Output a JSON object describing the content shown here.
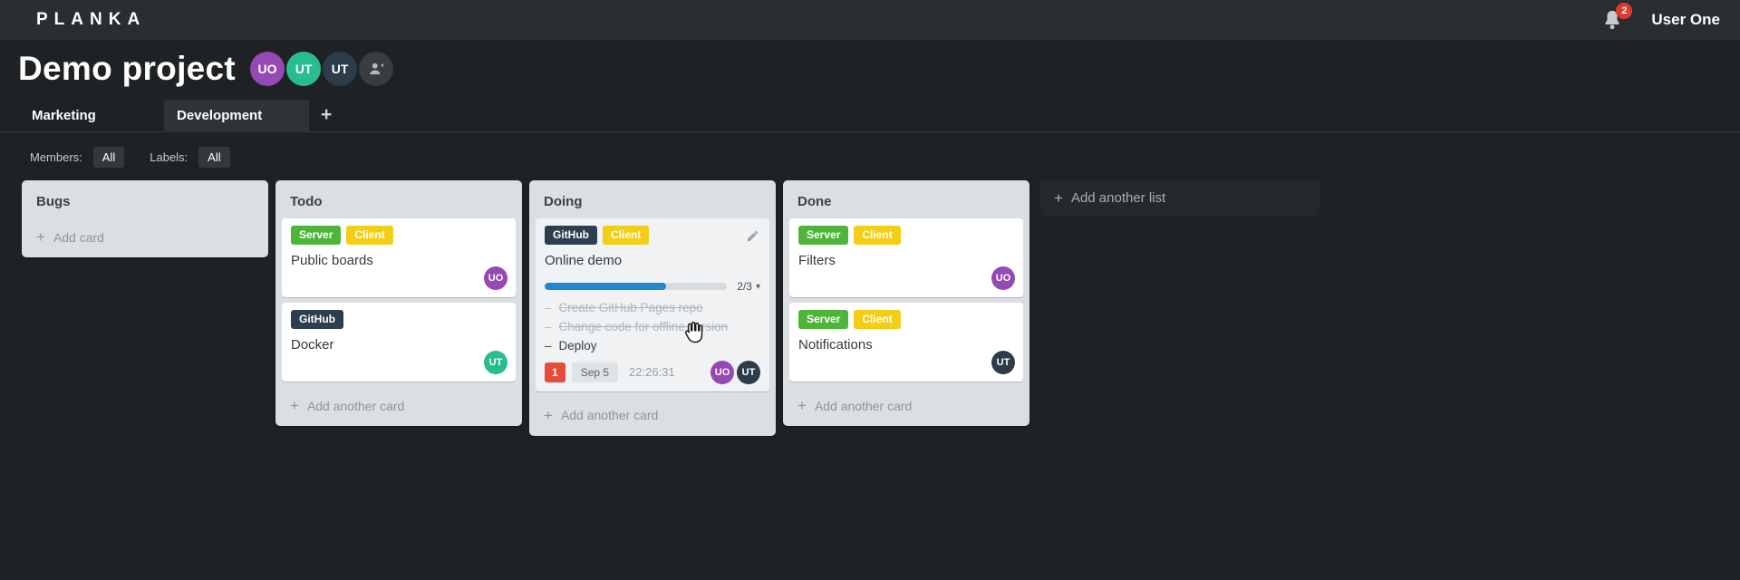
{
  "topbar": {
    "logo": "PLANKA",
    "user": "User One",
    "notifications": "2"
  },
  "project": {
    "title": "Demo project",
    "members": [
      {
        "initials": "UO",
        "color": "#9549b5"
      },
      {
        "initials": "UT",
        "color": "#28bd8f"
      },
      {
        "initials": "UT",
        "color": "#2d3c4b"
      }
    ]
  },
  "tabs": {
    "items": [
      {
        "label": "Marketing",
        "active": false
      },
      {
        "label": "Development",
        "active": true
      }
    ],
    "add": "+"
  },
  "filters": {
    "members_label": "Members:",
    "members_value": "All",
    "labels_label": "Labels:",
    "labels_value": "All"
  },
  "board": {
    "add_list_label": "Add another list",
    "lists": [
      {
        "title": "Bugs",
        "add_label": "Add card",
        "cards": []
      },
      {
        "title": "Todo",
        "add_label": "Add another card",
        "cards": [
          {
            "labels": [
              {
                "text": "Server",
                "color": "#4fb53a"
              },
              {
                "text": "Client",
                "color": "#f2ce16"
              }
            ],
            "title": "Public boards",
            "members": [
              {
                "initials": "UO",
                "color": "#9549b5"
              }
            ]
          },
          {
            "labels": [
              {
                "text": "GitHub",
                "color": "#2d3e50"
              }
            ],
            "title": "Docker",
            "members": [
              {
                "initials": "UT",
                "color": "#28bd8f"
              }
            ]
          }
        ]
      },
      {
        "title": "Doing",
        "add_label": "Add another card",
        "cards": [
          {
            "labels": [
              {
                "text": "GitHub",
                "color": "#2d3e50"
              },
              {
                "text": "Client",
                "color": "#f2ce16"
              }
            ],
            "title": "Online demo",
            "editable": true,
            "hover": true,
            "progress": {
              "done": 2,
              "total": 3,
              "label": "2/3",
              "percent": 66.7
            },
            "tasks": [
              {
                "text": "Create GitHub Pages repo",
                "completed": true
              },
              {
                "text": "Change code for offline version",
                "completed": true
              },
              {
                "text": "Deploy",
                "completed": false
              }
            ],
            "notification_count": "1",
            "due_date": "Sep 5",
            "timer": "22:26:31",
            "members": [
              {
                "initials": "UO",
                "color": "#9549b5"
              },
              {
                "initials": "UT",
                "color": "#2d3c4b"
              }
            ]
          }
        ]
      },
      {
        "title": "Done",
        "add_label": "Add another card",
        "cards": [
          {
            "labels": [
              {
                "text": "Server",
                "color": "#4fb53a"
              },
              {
                "text": "Client",
                "color": "#f2ce16"
              }
            ],
            "title": "Filters",
            "members": [
              {
                "initials": "UO",
                "color": "#9549b5"
              }
            ]
          },
          {
            "labels": [
              {
                "text": "Server",
                "color": "#4fb53a"
              },
              {
                "text": "Client",
                "color": "#f2ce16"
              }
            ],
            "title": "Notifications",
            "members": [
              {
                "initials": "UT",
                "color": "#2d3c4b"
              }
            ]
          }
        ]
      }
    ]
  }
}
